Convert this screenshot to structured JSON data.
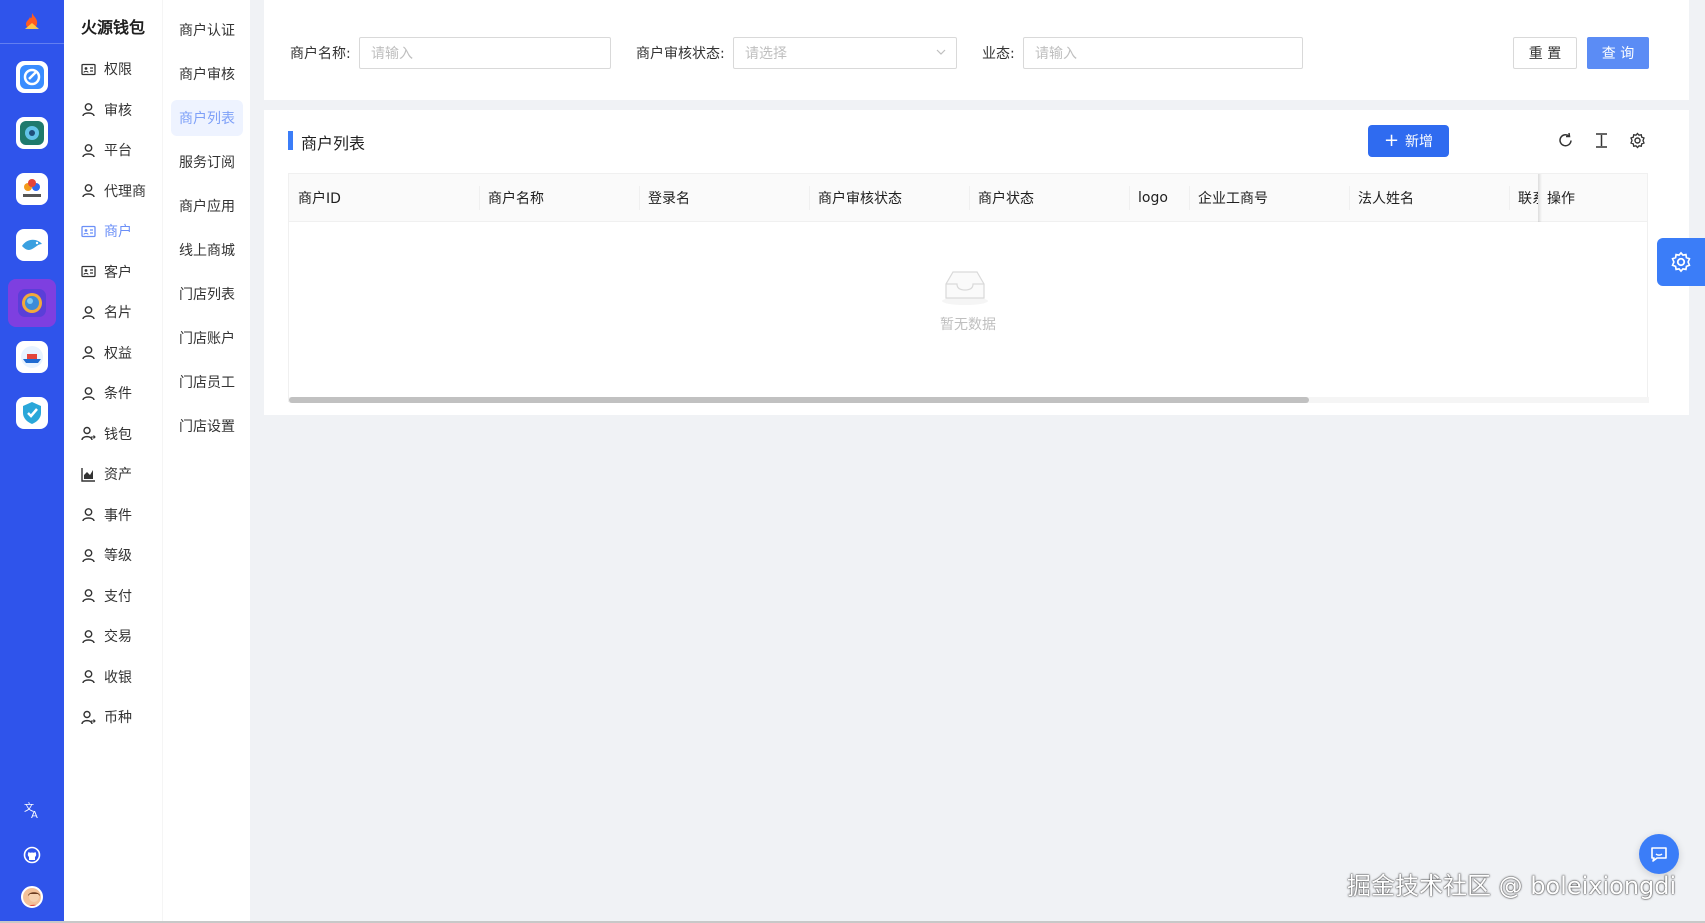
{
  "rail": {
    "logo_icon": "flame-logo-icon",
    "apps": [
      "app-c-icon",
      "app-gear-icon",
      "app-ranoption-icon",
      "app-bird-icon",
      "app-planet-icon",
      "app-boat-icon",
      "app-shield-icon"
    ],
    "bottom": [
      "translate-icon",
      "github-icon"
    ],
    "active_color": "#7e3fe0",
    "bg_color": "#2f54eb"
  },
  "nav1": {
    "title": "火源钱包",
    "items": [
      {
        "label": "权限",
        "icon": "idcard-icon"
      },
      {
        "label": "审核",
        "icon": "user-icon"
      },
      {
        "label": "平台",
        "icon": "user-icon"
      },
      {
        "label": "代理商",
        "icon": "user-icon"
      },
      {
        "label": "商户",
        "icon": "idcard-icon",
        "active": true
      },
      {
        "label": "客户",
        "icon": "idcard-icon"
      },
      {
        "label": "名片",
        "icon": "user-icon"
      },
      {
        "label": "权益",
        "icon": "user-icon"
      },
      {
        "label": "条件",
        "icon": "user-icon"
      },
      {
        "label": "钱包",
        "icon": "user-switch-icon"
      },
      {
        "label": "资产",
        "icon": "area-chart-icon"
      },
      {
        "label": "事件",
        "icon": "user-icon"
      },
      {
        "label": "等级",
        "icon": "user-icon"
      },
      {
        "label": "支付",
        "icon": "user-icon"
      },
      {
        "label": "交易",
        "icon": "user-icon"
      },
      {
        "label": "收银",
        "icon": "user-icon"
      },
      {
        "label": "币种",
        "icon": "user-switch-icon"
      }
    ]
  },
  "nav2": {
    "items": [
      "商户认证",
      "商户审核",
      "商户列表",
      "服务订阅",
      "商户应用",
      "线上商城",
      "门店列表",
      "门店账户",
      "门店员工",
      "门店设置"
    ],
    "active_index": 2
  },
  "search": {
    "merchant_name_label": "商户名称:",
    "merchant_name_placeholder": "请输入",
    "audit_status_label": "商户审核状态:",
    "audit_status_placeholder": "请选择",
    "business_label": "业态:",
    "business_placeholder": "请输入",
    "reset_label": "重 置",
    "query_label": "查 询"
  },
  "table_card": {
    "title": "商户列表",
    "add_label": "新增",
    "tools": [
      "reload-icon",
      "column-height-icon",
      "setting-icon"
    ],
    "columns": [
      "商户ID",
      "商户名称",
      "登录名",
      "商户审核状态",
      "商户状态",
      "logo",
      "企业工商号",
      "法人姓名",
      "联系",
      "操作"
    ],
    "empty_text": "暂无数据"
  },
  "floating": {
    "settings_icon": "setting-icon",
    "chat_icon": "chat-icon"
  },
  "watermark": "掘金技术社区 @ boleixiongdi",
  "colors": {
    "primary": "#2f6bf0",
    "query_button": "#5b8cf5",
    "active_menu": "#6b8ff7"
  }
}
